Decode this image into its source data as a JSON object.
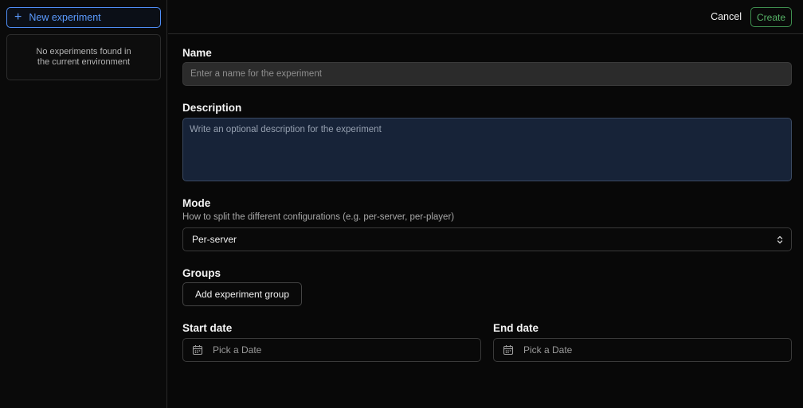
{
  "sidebar": {
    "new_experiment_label": "New experiment",
    "empty_message": "No experiments found in the current environment"
  },
  "topbar": {
    "cancel_label": "Cancel",
    "create_label": "Create"
  },
  "form": {
    "name": {
      "label": "Name",
      "placeholder": "Enter a name for the experiment",
      "value": ""
    },
    "description": {
      "label": "Description",
      "placeholder": "Write an optional description for the experiment",
      "value": ""
    },
    "mode": {
      "label": "Mode",
      "hint": "How to split the different configurations (e.g. per-server, per-player)",
      "selected": "Per-server"
    },
    "groups": {
      "label": "Groups",
      "add_label": "Add experiment group"
    },
    "start_date": {
      "label": "Start date",
      "placeholder": "Pick a Date"
    },
    "end_date": {
      "label": "End date",
      "placeholder": "Pick a Date"
    }
  },
  "colors": {
    "accent_blue": "#5b9bff",
    "create_green": "#57b367",
    "description_bg": "#172338"
  },
  "icons": [
    "plus-icon",
    "chevron-updown-icon",
    "calendar-icon"
  ]
}
